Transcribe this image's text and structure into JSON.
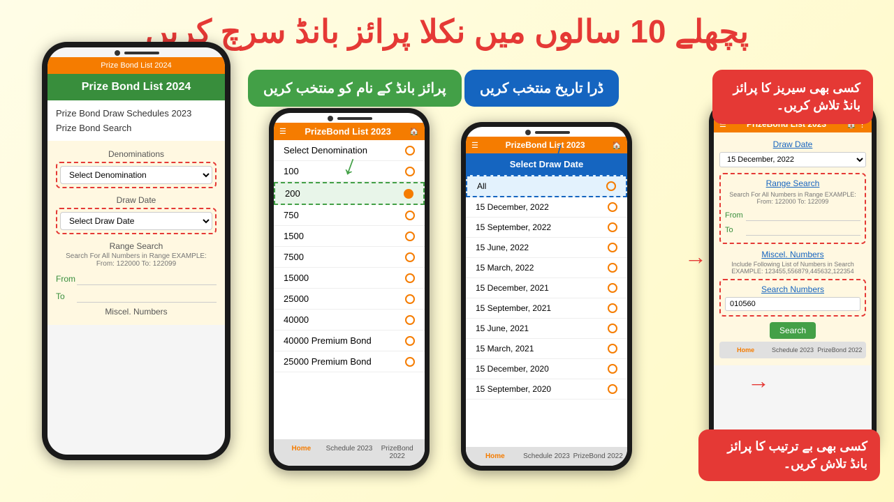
{
  "page": {
    "background": "#fffde7",
    "urdu_title": "پچھلے 10 سالوں میں نکلا پرائز بانڈ سرچ کریں"
  },
  "green_bubble": {
    "text": "پرائز بانڈ کے نام کو منتخب کریں"
  },
  "blue_bubble": {
    "text": "ڈرا تاریخ منتخب کریں"
  },
  "red_bubble_tr": {
    "text": "کسی بھی سیریز کا پرائز بانڈ تلاش کریں۔"
  },
  "red_bubble_br": {
    "text": "کسی بھی بے ترتیب کا پرائز بانڈ تلاش کریں۔"
  },
  "phone1": {
    "header": "Prize Bond List 2024",
    "title": "Prize Bond List 2024",
    "menu_items": [
      "Prize Bond Draw Schedules 2023",
      "Prize Bond Search"
    ],
    "denominations_label": "Denominations",
    "select_denomination_placeholder": "Select Denomination",
    "draw_date_label": "Draw Date",
    "select_draw_date_placeholder": "Select Draw Date",
    "range_search_label": "Range Search",
    "range_desc": "Search For All Numbers in Range EXAMPLE: From: 122000 To: 122099",
    "from_label": "From",
    "to_label": "To",
    "misc_label": "Miscel. Numbers"
  },
  "phone2": {
    "header_title": "PrizeBond List 2023",
    "denomination_options": [
      {
        "label": "Select Denomination",
        "selected": false
      },
      {
        "label": "100",
        "selected": false
      },
      {
        "label": "200",
        "selected": true
      },
      {
        "label": "750",
        "selected": false
      },
      {
        "label": "1500",
        "selected": false
      },
      {
        "label": "7500",
        "selected": false
      },
      {
        "label": "15000",
        "selected": false
      },
      {
        "label": "25000",
        "selected": false
      },
      {
        "label": "40000",
        "selected": false
      },
      {
        "label": "40000 Premium Bond",
        "selected": false
      },
      {
        "label": "25000 Premium Bond",
        "selected": false
      }
    ],
    "footer_tabs": [
      "Home",
      "Schedule 2023",
      "PrizeBond 2022"
    ]
  },
  "phone3": {
    "header_title": "PrizeBond List 2023",
    "select_draw_date": "Select Draw Date",
    "draw_dates": [
      {
        "label": "All",
        "selected": false
      },
      {
        "label": "15 December, 2022",
        "selected": false
      },
      {
        "label": "15 September, 2022",
        "selected": false
      },
      {
        "label": "15 June, 2022",
        "selected": false
      },
      {
        "label": "15 March, 2022",
        "selected": false
      },
      {
        "label": "15 December, 2021",
        "selected": false
      },
      {
        "label": "15 September, 2021",
        "selected": false
      },
      {
        "label": "15 June, 2021",
        "selected": false
      },
      {
        "label": "15 March, 2021",
        "selected": false
      },
      {
        "label": "15 December, 2020",
        "selected": false
      },
      {
        "label": "15 September, 2020",
        "selected": false
      }
    ],
    "footer_tabs": [
      "Home",
      "Schedule 2023",
      "PrizeBond 2022"
    ]
  },
  "phone4": {
    "header_title": "PrizeBond List 2023",
    "draw_date_label": "Draw Date",
    "draw_date_value": "15 December, 2022",
    "range_search_label": "Range Search",
    "range_desc": "Search For All Numbers in Range EXAMPLE: From: 122000 To: 122099",
    "from_label": "From",
    "to_label": "To",
    "misc_label": "Miscel. Numbers",
    "misc_desc": "Include Following List of Numbers in Search EXAMPLE: 123455,556879,445632,122354",
    "search_numbers_label": "Search Numbers",
    "search_numbers_value": "010560",
    "search_button": "Search",
    "footer_tabs": [
      "Home",
      "Schedule 2023",
      "PrizeBond 2022"
    ]
  }
}
